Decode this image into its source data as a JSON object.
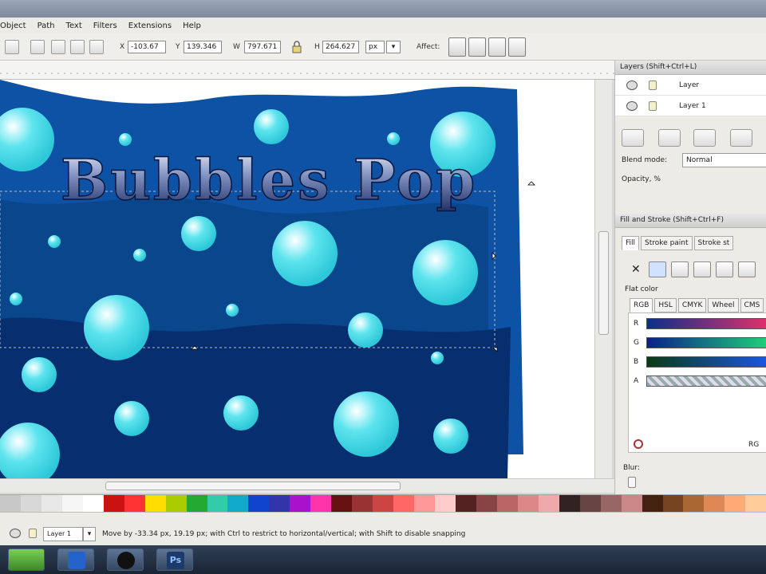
{
  "window": {
    "title": ""
  },
  "menu": {
    "items": [
      "Object",
      "Path",
      "Text",
      "Filters",
      "Extensions",
      "Help"
    ]
  },
  "toolbar": {
    "x_label": "X",
    "x_value": "-103.67",
    "y_label": "Y",
    "y_value": "139.346",
    "w_label": "W",
    "w_value": "797.671",
    "h_label": "H",
    "h_value": "264.627",
    "unit": "px",
    "affect_label": "Affect:"
  },
  "canvas": {
    "artwork_title": "Bubbles Pop",
    "bubble_color": "#5ee4ee",
    "background_colors": [
      "#0d4f9e",
      "#0a4588",
      "#062f6e"
    ]
  },
  "layers_panel": {
    "title": "Layers (Shift+Ctrl+L)",
    "layers": [
      {
        "name": "Layer"
      },
      {
        "name": "Layer 1"
      }
    ],
    "blend_label": "Blend mode:",
    "blend_value": "Normal",
    "opacity_label": "Opacity, %"
  },
  "fill_stroke_panel": {
    "title": "Fill and Stroke (Shift+Ctrl+F)",
    "tabs": [
      "Fill",
      "Stroke paint",
      "Stroke st"
    ],
    "flat_color_label": "Flat color",
    "color_tabs": [
      "RGB",
      "HSL",
      "CMYK",
      "Wheel",
      "CMS"
    ],
    "channels": [
      "R",
      "G",
      "B",
      "A"
    ],
    "rgba_label": "RG",
    "blur_label": "Blur:"
  },
  "palette": {
    "colors": [
      "#c8c8c8",
      "#d8d8d8",
      "#e8e8e8",
      "#f6f6f6",
      "#ffffff",
      "#cc1111",
      "#ff3333",
      "#ffdd00",
      "#aacc00",
      "#22aa33",
      "#33ccaa",
      "#11aacc",
      "#1144cc",
      "#3333aa",
      "#aa11cc",
      "#ff33aa",
      "#661111",
      "#993333",
      "#cc4444",
      "#ff6666",
      "#ff9999",
      "#ffcccc",
      "#552222",
      "#884444",
      "#bb6666",
      "#dd8888",
      "#eeaaaa",
      "#332222",
      "#664444",
      "#996666",
      "#cc8888",
      "#442211",
      "#774422",
      "#aa6633",
      "#dd8855",
      "#ffaa77",
      "#ffcc99"
    ]
  },
  "status": {
    "layer_value": "Layer 1",
    "message": "Move by -33.34 px, 19.19 px; with Ctrl to restrict to horizontal/vertical; with Shift to disable snapping"
  },
  "taskbar": {
    "icons": [
      "start-icon",
      "app-icon",
      "inkscape-icon",
      "photoshop-icon"
    ],
    "ps_label": "Ps"
  }
}
